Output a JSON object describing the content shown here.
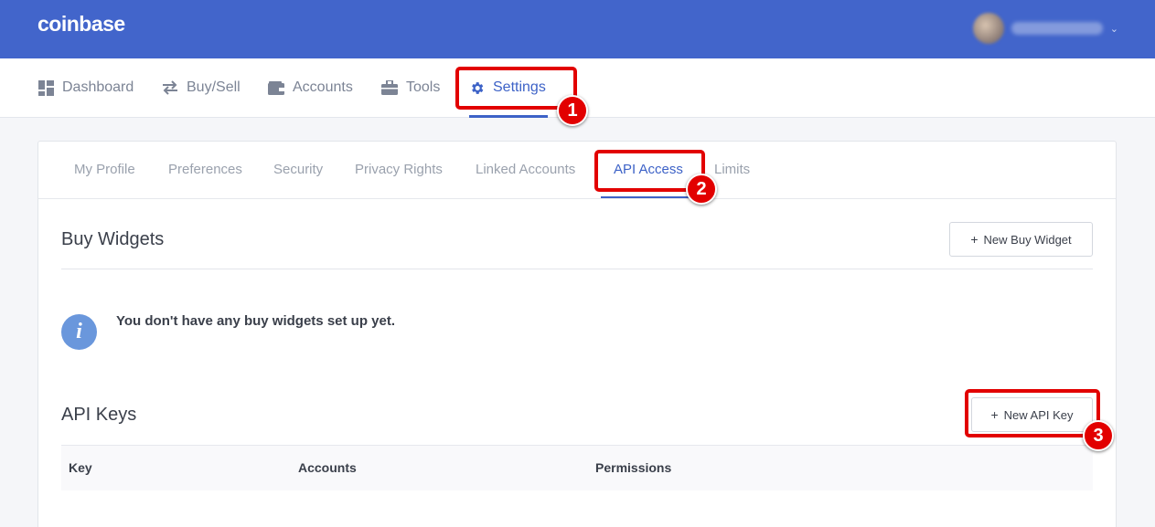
{
  "header": {
    "logo": "coinbase",
    "user_menu_chevron": "⌄"
  },
  "main_nav": [
    {
      "label": "Dashboard",
      "icon": "dashboard-icon"
    },
    {
      "label": "Buy/Sell",
      "icon": "swap-arrows-icon"
    },
    {
      "label": "Accounts",
      "icon": "wallet-icon"
    },
    {
      "label": "Tools",
      "icon": "toolbox-icon"
    },
    {
      "label": "Settings",
      "icon": "gear-icon",
      "active": true
    }
  ],
  "settings_tabs": [
    {
      "label": "My Profile"
    },
    {
      "label": "Preferences"
    },
    {
      "label": "Security"
    },
    {
      "label": "Privacy Rights"
    },
    {
      "label": "Linked Accounts"
    },
    {
      "label": "API Access",
      "active": true
    },
    {
      "label": "Limits"
    }
  ],
  "buy_widgets": {
    "title": "Buy Widgets",
    "button_label": "New Buy Widget",
    "empty_message": "You don't have any buy widgets set up yet."
  },
  "api_keys": {
    "title": "API Keys",
    "button_label": "New API Key",
    "columns": [
      "Key",
      "Accounts",
      "Permissions"
    ]
  },
  "annotations": [
    {
      "number": "1"
    },
    {
      "number": "2"
    },
    {
      "number": "3"
    }
  ],
  "colors": {
    "brand_blue": "#4265cb",
    "active_blue": "#3d62c7",
    "callout_red": "#e20000",
    "info_blue": "#6a97dc"
  }
}
